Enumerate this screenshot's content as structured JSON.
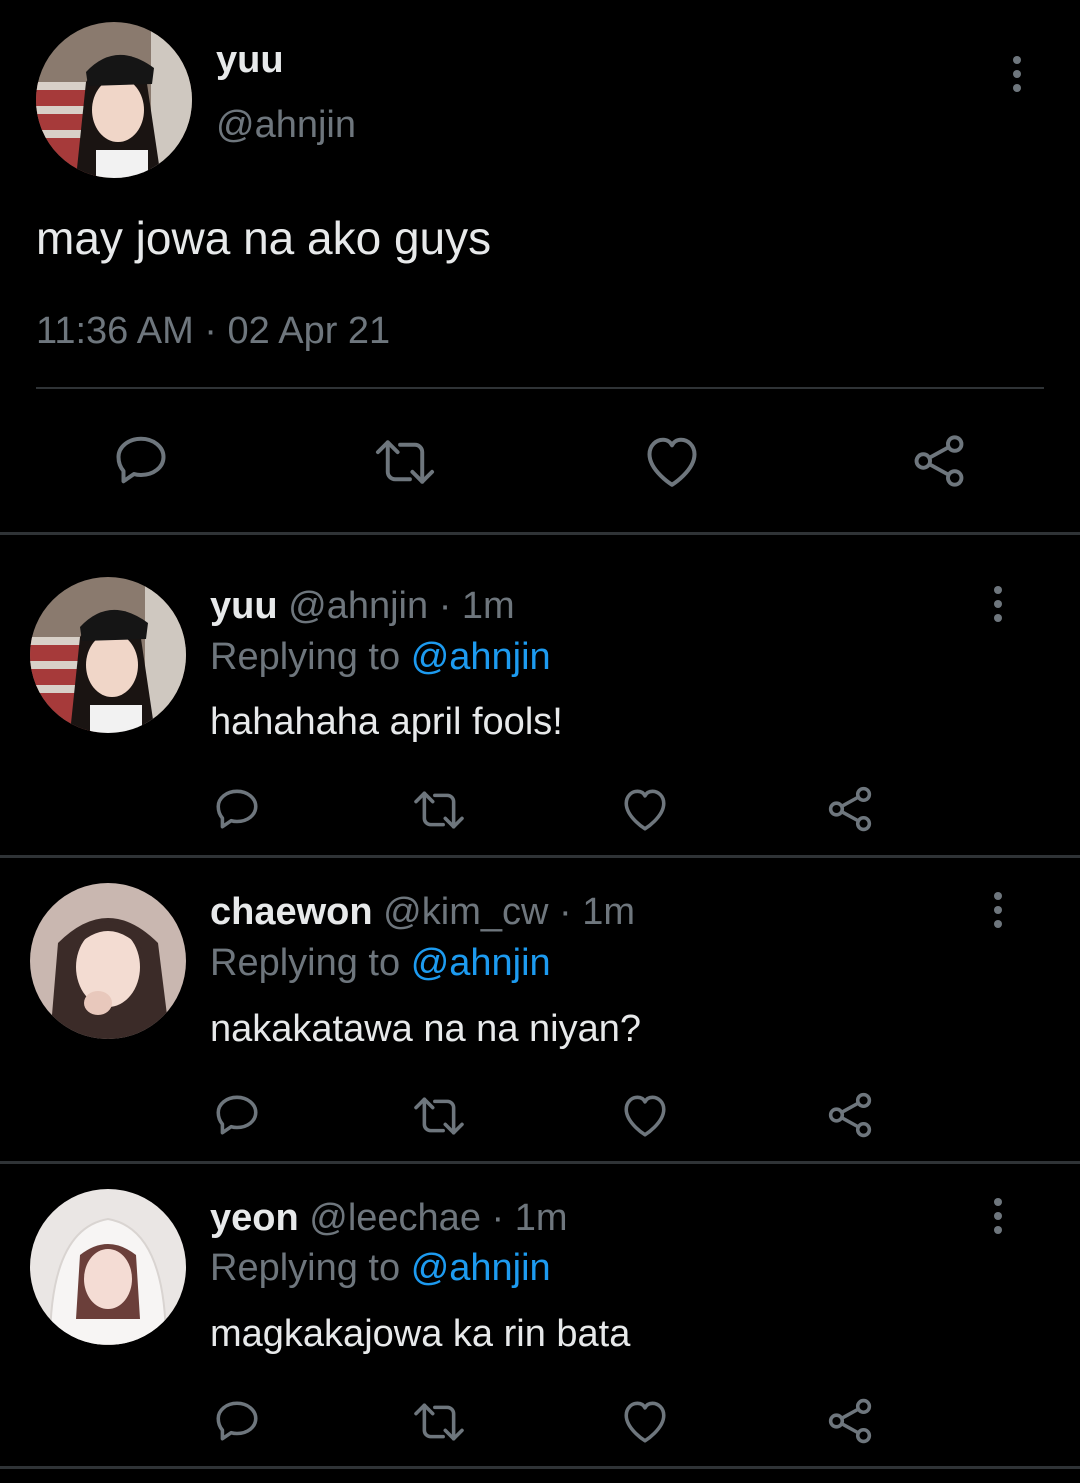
{
  "main_tweet": {
    "display_name": "yuu",
    "handle": "@ahnjin",
    "text": "may jowa na ako guys",
    "timestamp": "11:36 AM · 02 Apr 21"
  },
  "replies": [
    {
      "display_name": "yuu",
      "handle": "@ahnjin",
      "time": "· 1m",
      "replying_prefix": "Replying to",
      "replying_to": "@ahnjin",
      "text": "hahahaha april fools!"
    },
    {
      "display_name": "chaewon",
      "handle": "@kim_cw",
      "time": "· 1m",
      "replying_prefix": "Replying to",
      "replying_to": "@ahnjin",
      "text": "nakakatawa na na niyan?"
    },
    {
      "display_name": "yeon",
      "handle": "@leechae",
      "time": "· 1m",
      "replying_prefix": "Replying to",
      "replying_to": "@ahnjin",
      "text": "magkakajowa ka rin bata"
    }
  ],
  "icons": {
    "reply": "comment-icon",
    "retweet": "retweet-icon",
    "like": "heart-icon",
    "share": "share-icon",
    "more": "more-vertical-icon"
  },
  "colors": {
    "background": "#000000",
    "muted": "#6e767d",
    "link": "#1d9bf0",
    "divider": "#2f3336"
  }
}
